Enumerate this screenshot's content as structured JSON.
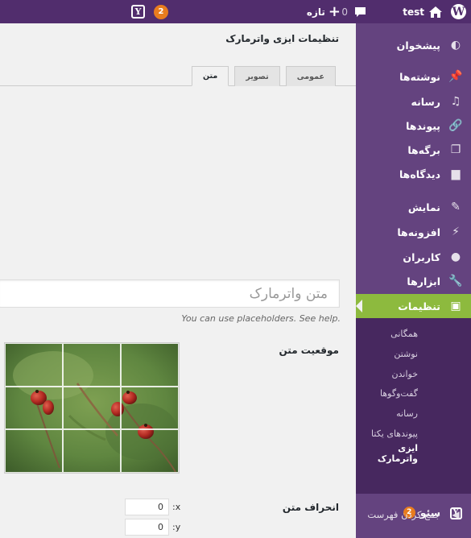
{
  "adminbar": {
    "site_name": "test",
    "comments_count": "0",
    "new_label": "تازه",
    "updates_count": "2"
  },
  "sidebar": {
    "items": [
      {
        "label": "پیشخوان",
        "icon": "dashboard-icon"
      },
      {
        "label": "نوشته‌ها",
        "icon": "pin-icon"
      },
      {
        "label": "رسانه",
        "icon": "media-icon"
      },
      {
        "label": "پیوندها",
        "icon": "link-icon"
      },
      {
        "label": "برگه‌ها",
        "icon": "pages-icon"
      },
      {
        "label": "دیدگاه‌ها",
        "icon": "comments-icon"
      },
      {
        "label": "نمایش",
        "icon": "appearance-icon"
      },
      {
        "label": "افزونه‌ها",
        "icon": "plugins-icon"
      },
      {
        "label": "کاربران",
        "icon": "users-icon"
      },
      {
        "label": "ابزارها",
        "icon": "tools-icon"
      },
      {
        "label": "تنظیمات",
        "icon": "settings-icon"
      }
    ],
    "submenu": [
      "همگانی",
      "نوشتن",
      "خواندن",
      "گفت‌وگوها",
      "رسانه",
      "پیوندهای یکتا",
      "ایزی واترمارک"
    ],
    "seo_label": "سئو",
    "seo_badge": "2",
    "collapse_label": "جمع کردن فهرست"
  },
  "content": {
    "title": "تنظیمات ایزی واترمارک",
    "tabs": [
      "عمومی",
      "تصویر",
      "متن"
    ],
    "text_input_placeholder": "متن واترمارک",
    "help_text": "You can use placeholders. See help.",
    "position_label": "موقعیت متن",
    "offset_label": "انحراف متن",
    "offset_x": "0",
    "offset_y": "0",
    "axis_x": ":x",
    "axis_y": ":y"
  },
  "colors": {
    "adminbar": "#512d6d",
    "sidebar": "#64437f",
    "submenu": "#47285f",
    "accent": "#8dba3e",
    "badge": "#e87c1e"
  }
}
